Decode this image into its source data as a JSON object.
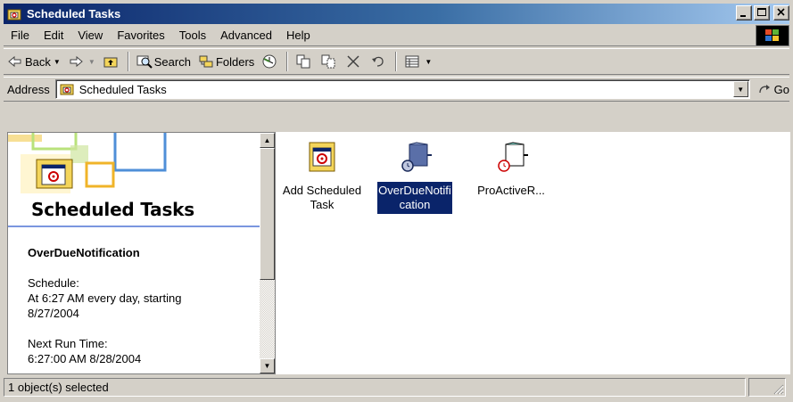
{
  "window": {
    "title": "Scheduled Tasks",
    "caption_buttons": [
      "minimize",
      "maximize",
      "close"
    ]
  },
  "menu": {
    "items": [
      "File",
      "Edit",
      "View",
      "Favorites",
      "Tools",
      "Advanced",
      "Help"
    ]
  },
  "toolbar": {
    "back_label": "Back",
    "search_label": "Search",
    "folders_label": "Folders"
  },
  "address": {
    "label": "Address",
    "value": "Scheduled Tasks",
    "go_label": "Go"
  },
  "left_pane": {
    "title": "Scheduled Tasks",
    "selected_name": "OverDueNotification",
    "schedule_label": "Schedule:",
    "schedule_value": "At 6:27 AM every day, starting 8/27/2004",
    "next_run_label": "Next Run Time:",
    "next_run_value": "6:27:00 AM 8/28/2004"
  },
  "items": [
    {
      "label_line1": "Add Scheduled",
      "label_line2": "Task",
      "icon": "add-task-icon",
      "selected": false
    },
    {
      "label_line1": "OverDueNotifi",
      "label_line2": "cation",
      "icon": "task-icon",
      "selected": true
    },
    {
      "label_line1": "ProActiveR...",
      "label_line2": "",
      "icon": "task-icon",
      "selected": false
    }
  ],
  "status": {
    "text": "1 object(s) selected"
  },
  "colors": {
    "titlebar_start": "#0a246a",
    "titlebar_end": "#a6caf0",
    "selection": "#0a246a",
    "face": "#d4d0c8"
  }
}
